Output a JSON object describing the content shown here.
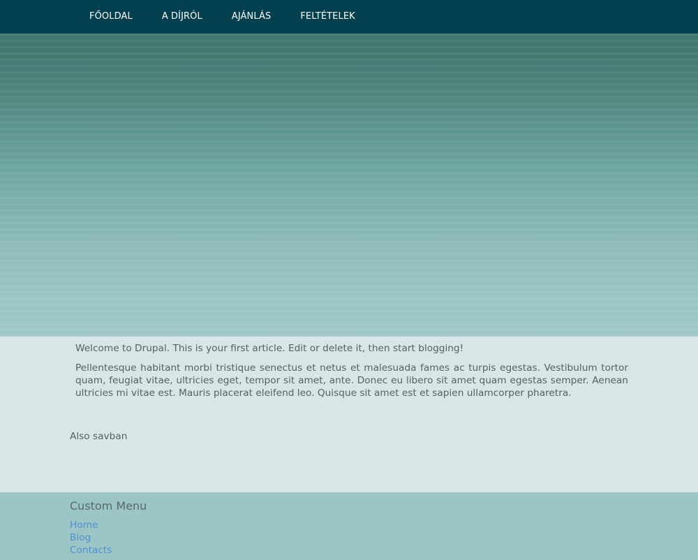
{
  "navigation": {
    "items": [
      {
        "label": "FŐOLDAL"
      },
      {
        "label": "A DÍJRÓL"
      },
      {
        "label": "AJÁNLÁS"
      },
      {
        "label": "FELTÉTELEK"
      }
    ]
  },
  "article": {
    "intro": "Welcome to Drupal. This is your first article. Edit or delete it, then start blogging!",
    "body": "Pellentesque habitant morbi tristique senectus et netus et malesuada fames ac turpis egestas. Vestibulum tortor quam, feugiat vitae, ultricies eget, tempor sit amet, ante. Donec eu libero sit amet quam egestas semper. Aenean ultricies mi vitae est. Mauris placerat eleifend leo. Quisque sit amet est et sapien ullamcorper pharetra."
  },
  "region": {
    "also_text": "Also savban"
  },
  "footer": {
    "title": "Custom Menu",
    "links": [
      {
        "label": "Home"
      },
      {
        "label": "Blog"
      },
      {
        "label": "Contacts"
      }
    ]
  },
  "colors": {
    "top_nav": "#024050",
    "content_bg": "#d7e6e7",
    "footer_bg": "#9cc6c5",
    "link": "#4f90d1"
  }
}
